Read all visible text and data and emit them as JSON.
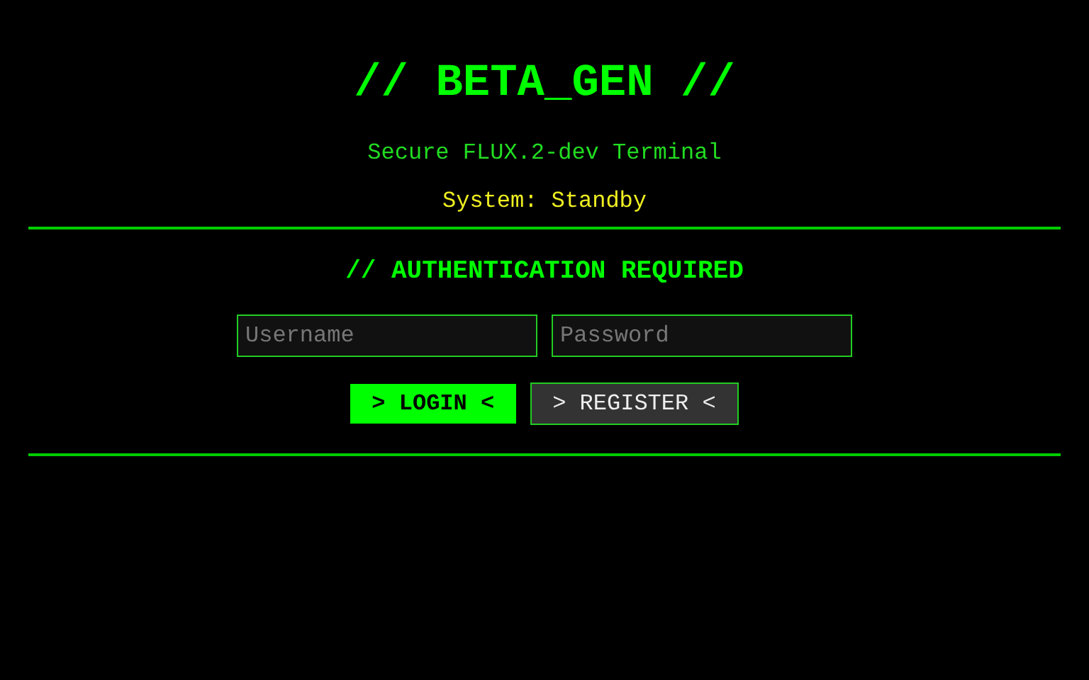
{
  "header": {
    "title": "// BETA_GEN //",
    "subtitle": "Secure FLUX.2-dev Terminal",
    "status": "System: Standby"
  },
  "auth": {
    "heading": "// AUTHENTICATION REQUIRED",
    "fields": [
      {
        "placeholder": "Username"
      },
      {
        "placeholder": "Password"
      }
    ],
    "buttons": [
      {
        "label": "> LOGIN <",
        "kind": "primary"
      },
      {
        "label": "> REGISTER <",
        "kind": "secondary"
      }
    ]
  }
}
